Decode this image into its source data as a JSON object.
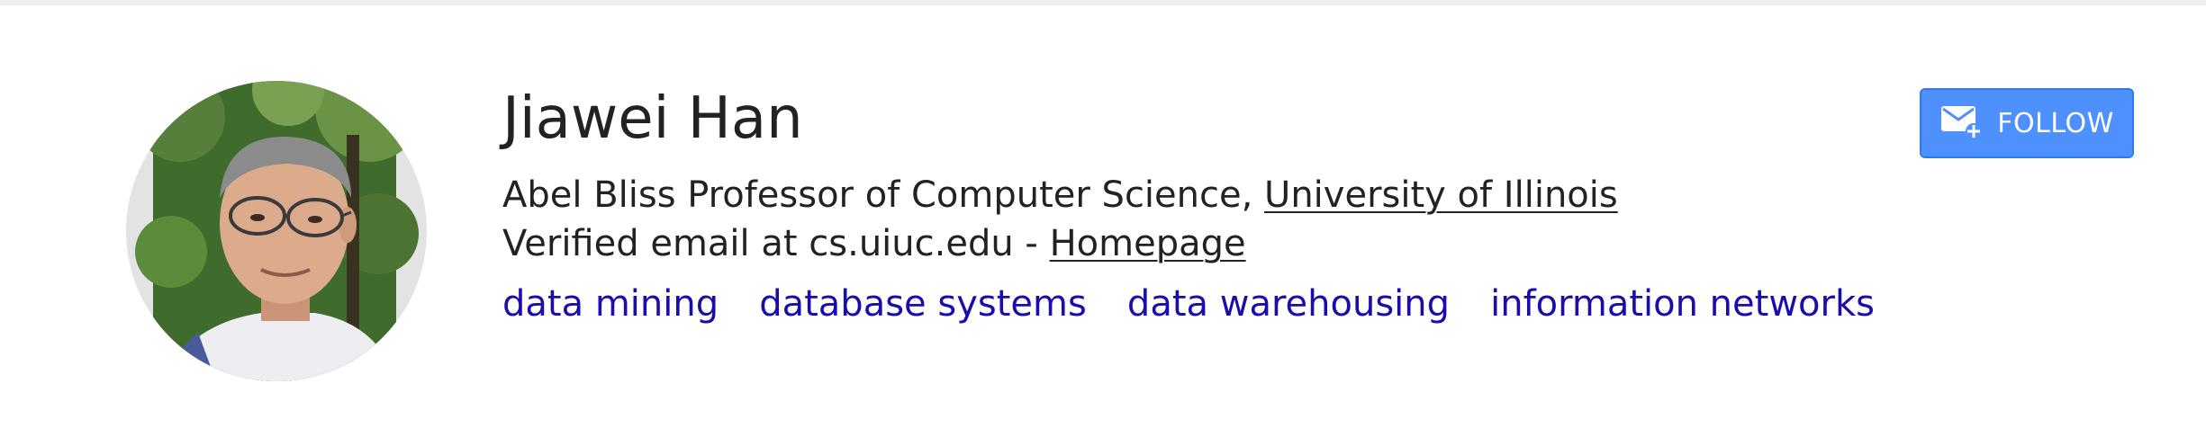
{
  "profile": {
    "name": "Jiawei Han",
    "affiliation_prefix": "Abel Bliss Professor of Computer Science, ",
    "affiliation_org": "University of Illinois",
    "email_text": "Verified email at cs.uiuc.edu - ",
    "homepage_label": "Homepage",
    "interests": [
      "data mining",
      "database systems",
      "data warehousing",
      "information networks"
    ]
  },
  "follow_button": {
    "label": "FOLLOW",
    "icon": "mail-plus-icon"
  },
  "colors": {
    "accent": "#4d90fe",
    "link_blue": "#1a0dab",
    "text": "#222222"
  }
}
